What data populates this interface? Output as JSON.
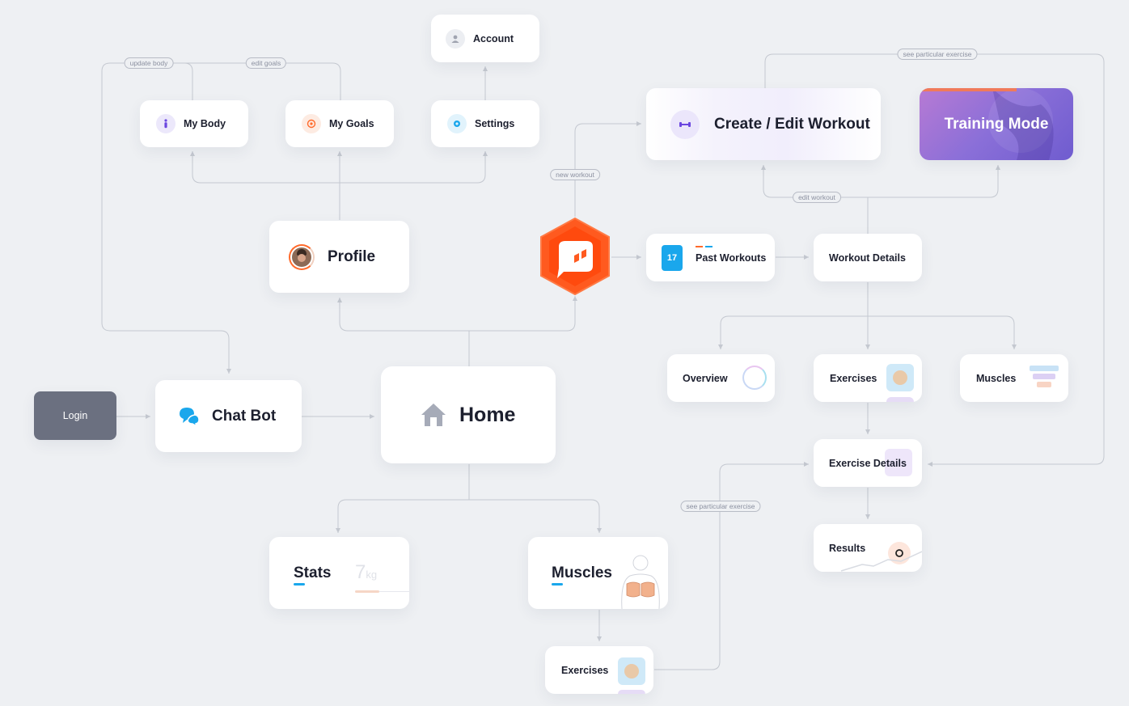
{
  "nodes": {
    "login": "Login",
    "chatbot": "Chat Bot",
    "home": "Home",
    "profile": "Profile",
    "my_body": "My Body",
    "my_goals": "My Goals",
    "settings": "Settings",
    "account": "Account",
    "create_workout": "Create / Edit Workout",
    "training_mode": "Training Mode",
    "past_workouts": "Past Workouts",
    "calendar_day": "17",
    "workout_details": "Workout Details",
    "overview": "Overview",
    "exercises_top": "Exercises",
    "muscles_top": "Muscles",
    "exercise_details": "Exercise Details",
    "results": "Results",
    "stats": "Stats",
    "stats_value": "7",
    "stats_unit": "kg",
    "muscles_bottom": "Muscles",
    "exercises_bottom": "Exercises"
  },
  "edge_labels": {
    "update_body": "update body",
    "edit_goals": "edit goals",
    "see_exercise_top": "see particular exercise",
    "new_workout": "new workout",
    "edit_workout": "edit workout",
    "see_exercise_bottom": "see particular exercise"
  },
  "colors": {
    "background": "#eef0f3",
    "edge": "#c4c8d0",
    "hub_orange": "#ff5a1f",
    "accent_blue": "#1aa7ec",
    "login_bg": "#6b7080",
    "training_purple": "#8a6fd8"
  }
}
